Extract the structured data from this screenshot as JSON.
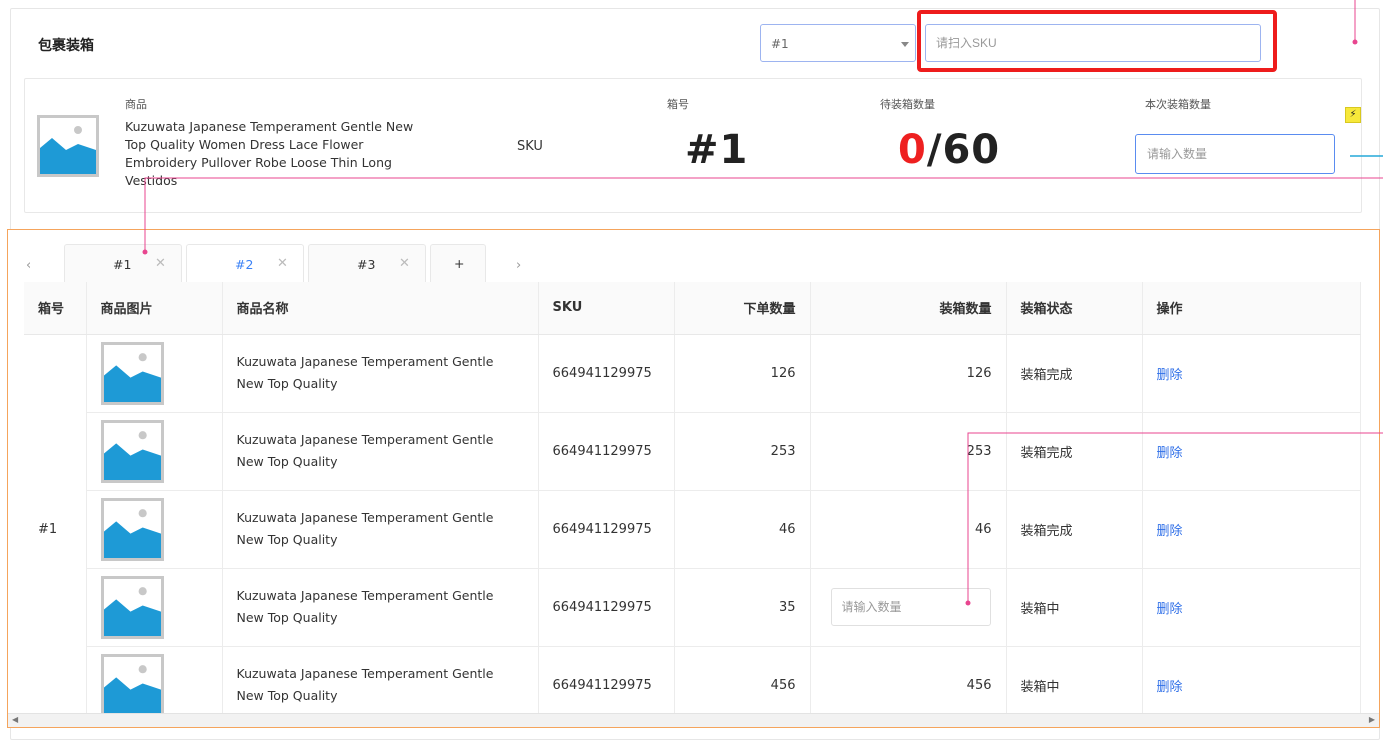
{
  "header": {
    "title": "包裹装箱",
    "box_select": {
      "value": "#1"
    },
    "sku_input": {
      "placeholder": "请扫入SKU"
    }
  },
  "info": {
    "product_label": "商品",
    "product_name": "Kuzuwata Japanese Temperament Gentle New Top Quality Women Dress Lace Flower Embroidery Pullover Robe Loose Thin Long Vestidos",
    "sku_label": "SKU",
    "box_label": "箱号",
    "box_value": "#1",
    "pending_label": "待装箱数量",
    "pending_done": "0",
    "pending_total": "/60",
    "this_label": "本次装箱数量",
    "qty_placeholder": "请输入数量"
  },
  "tabs": [
    {
      "label": "#1",
      "active": false
    },
    {
      "label": "#2",
      "active": true
    },
    {
      "label": "#3",
      "active": false
    }
  ],
  "tab_add": "+",
  "table": {
    "headers": [
      "箱号",
      "商品图片",
      "商品名称",
      "SKU",
      "下单数量",
      "装箱数量",
      "装箱状态",
      "操作"
    ],
    "box_no": "#1",
    "rows": [
      {
        "name": "Kuzuwata Japanese Temperament Gentle New Top Quality",
        "sku": "664941129975",
        "ordered": "126",
        "packed": "126",
        "status": "装箱完成",
        "action": "删除"
      },
      {
        "name": "Kuzuwata Japanese Temperament Gentle New Top Quality",
        "sku": "664941129975",
        "ordered": "253",
        "packed": "253",
        "status": "装箱完成",
        "action": "删除"
      },
      {
        "name": "Kuzuwata Japanese Temperament Gentle New Top Quality",
        "sku": "664941129975",
        "ordered": "46",
        "packed": "46",
        "status": "装箱完成",
        "action": "删除"
      },
      {
        "name": "Kuzuwata Japanese Temperament Gentle New Top Quality",
        "sku": "664941129975",
        "ordered": "35",
        "packed": "",
        "packed_placeholder": "请输入数量",
        "status": "装箱中",
        "action": "删除"
      },
      {
        "name": "Kuzuwata Japanese Temperament Gentle New Top Quality",
        "sku": "664941129975",
        "ordered": "456",
        "packed": "456",
        "status": "装箱中",
        "action": "删除"
      }
    ]
  },
  "colors": {
    "accent": "#3b82f6",
    "highlight_frame": "#ee1c1c",
    "pending_red": "#ee2020",
    "table_border": "#f5a45c",
    "annotation_pink": "#e8458f",
    "annotation_cyan": "#25a9d8"
  },
  "icons": {
    "image_placeholder": "image-placeholder-icon",
    "bolt": "lightning-icon",
    "tab_close": "close-icon"
  }
}
